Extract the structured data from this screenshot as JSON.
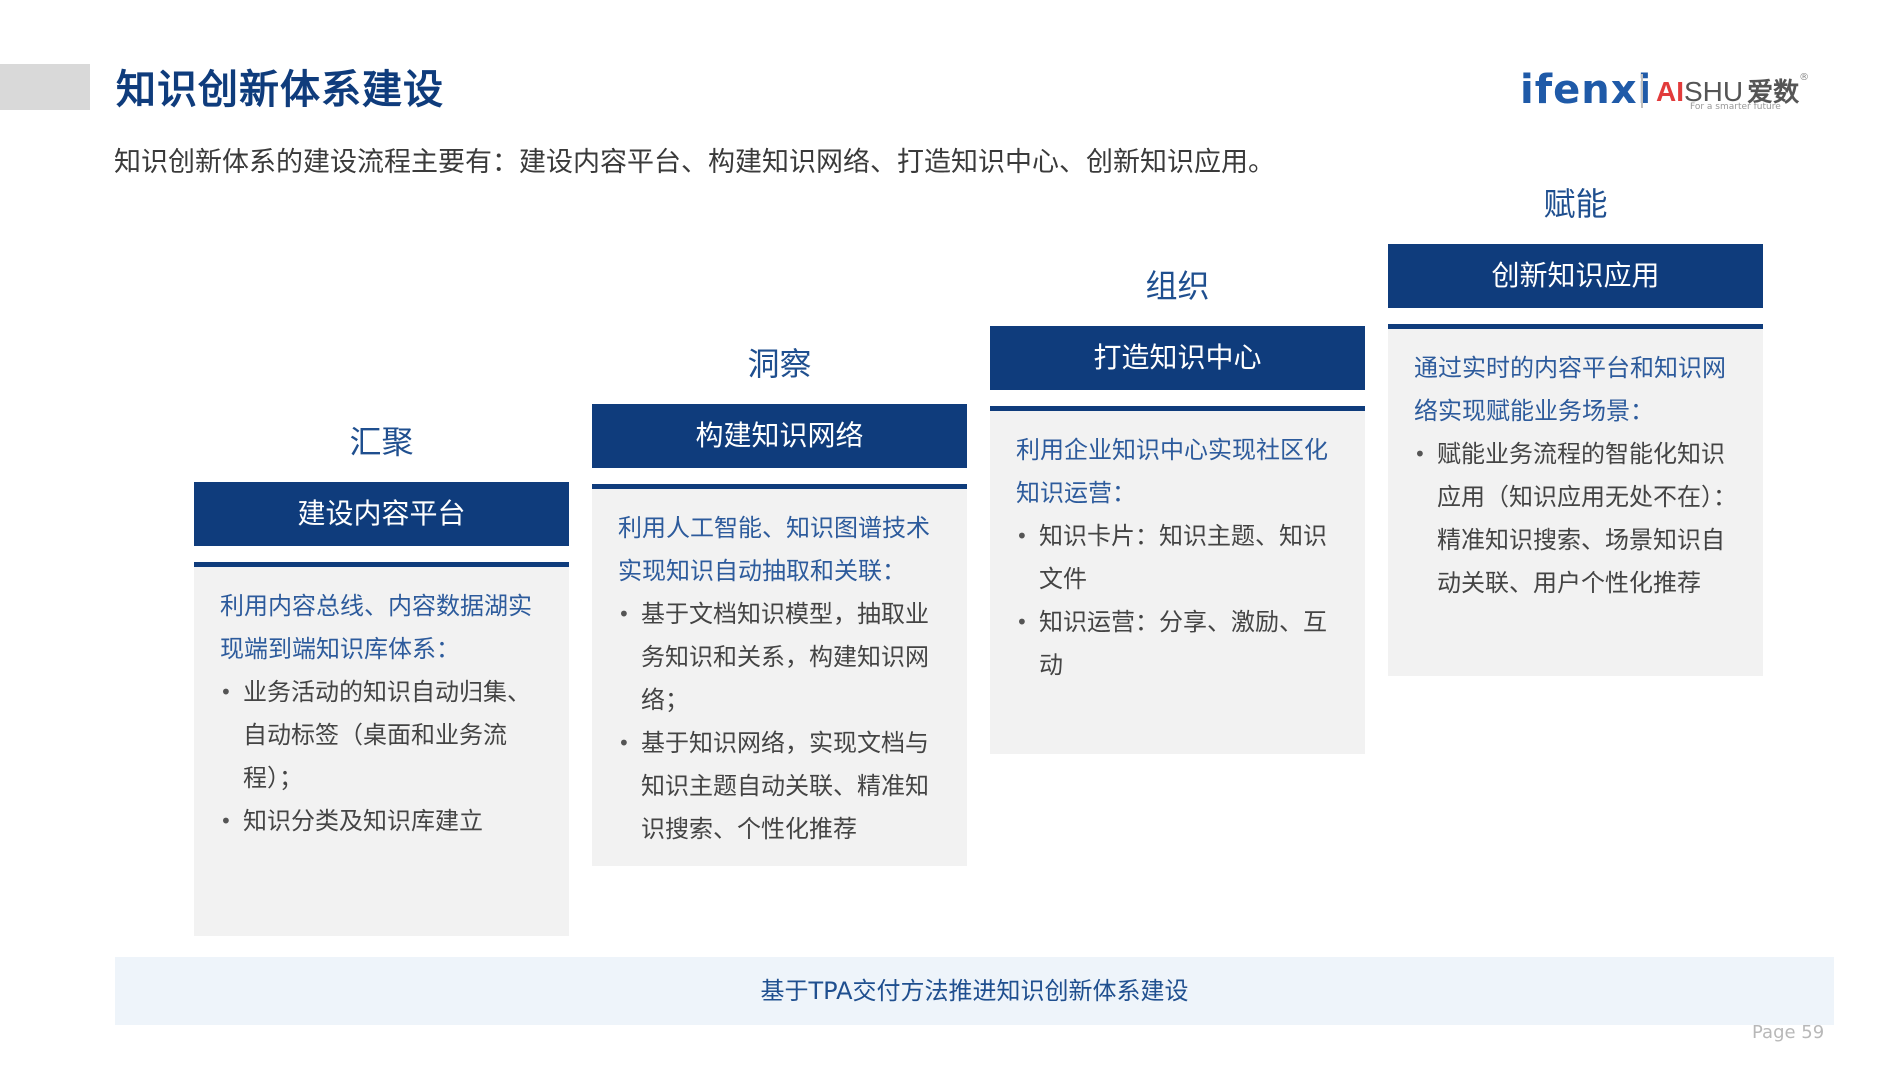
{
  "header": {
    "title": "知识创新体系建设",
    "subtitle": "知识创新体系的建设流程主要有：建设内容平台、构建知识网络、打造知识中心、创新知识应用。"
  },
  "logos": {
    "ifenxi": "ifenxi",
    "aishu_ai": "AI",
    "aishu_shu": "SHU",
    "aishu_cn": "爱数",
    "aishu_reg": "®",
    "aishu_tagline": "For a smarter future"
  },
  "stages": [
    {
      "verb": "汇聚",
      "title": "建设内容平台",
      "lead": "利用内容总线、内容数据湖实现端到端知识库体系：",
      "bullets": [
        "业务活动的知识自动归集、自动标签（桌面和业务流程）；",
        "知识分类及知识库建立"
      ]
    },
    {
      "verb": "洞察",
      "title": "构建知识网络",
      "lead": "利用人工智能、知识图谱技术实现知识自动抽取和关联：",
      "bullets": [
        "基于文档知识模型，抽取业务知识和关系，构建知识网络；",
        "基于知识网络，实现文档与知识主题自动关联、精准知识搜索、个性化推荐"
      ]
    },
    {
      "verb": "组织",
      "title": "打造知识中心",
      "lead": "利用企业知识中心实现社区化知识运营：",
      "bullets": [
        "知识卡片：知识主题、知识文件",
        "知识运营：分享、激励、互动"
      ]
    },
    {
      "verb": "赋能",
      "title": "创新知识应用",
      "lead": "通过实时的内容平台和知识网络实现赋能业务场景：",
      "bullets": [
        "赋能业务流程的智能化知识应用（知识应用无处不在）：精准知识搜索、场景知识自动关联、用户个性化推荐"
      ]
    }
  ],
  "banner": "基于TPA交付方法推进知识创新体系建设",
  "page": "Page  59"
}
